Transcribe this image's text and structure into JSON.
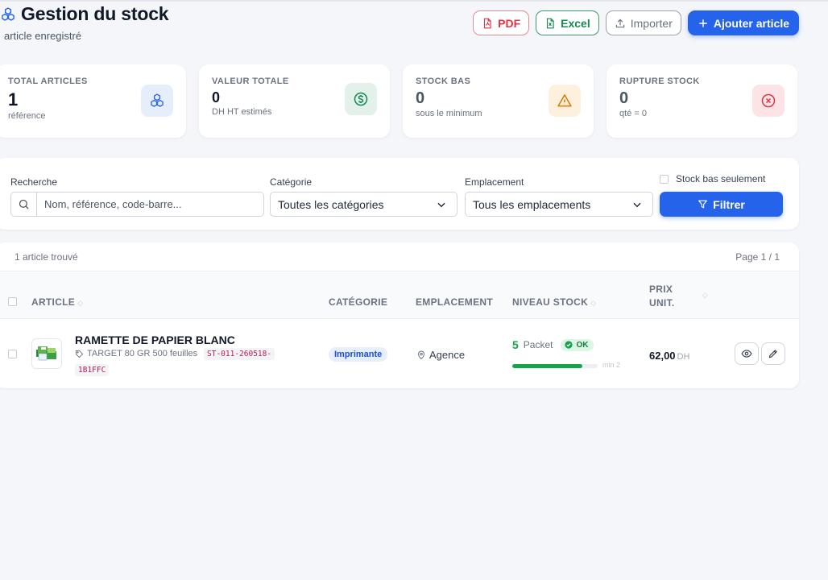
{
  "header": {
    "title": "Gestion du stock",
    "subtitle": "article enregistré",
    "buttons": {
      "pdf": "PDF",
      "excel": "Excel",
      "import": "Importer",
      "add": "Ajouter article"
    }
  },
  "stats": [
    {
      "label": "TOTAL ARTICLES",
      "value": "1",
      "sub": "référence",
      "icon": "cubes-icon",
      "color": "#2563eb"
    },
    {
      "label": "VALEUR TOTALE",
      "value": "0",
      "sub": "DH HT estimés",
      "icon": "dollar-coin-icon",
      "color": "#198754"
    },
    {
      "label": "STOCK BAS",
      "value": "0",
      "sub": "sous le minimum",
      "icon": "warning-icon",
      "color": "#d97706"
    },
    {
      "label": "RUPTURE STOCK",
      "value": "0",
      "sub": "qté = 0",
      "icon": "x-circle-icon",
      "color": "#dc3545"
    }
  ],
  "filters": {
    "search_label": "Recherche",
    "search_placeholder": "Nom, référence, code-barre...",
    "category_label": "Catégorie",
    "category_value": "Toutes les catégories",
    "location_label": "Emplacement",
    "location_value": "Tous les emplacements",
    "low_stock_label": "Stock bas seulement",
    "low_stock_checked": false,
    "filter_button": "Filtrer"
  },
  "table": {
    "count_text": "1 article trouvé",
    "page_text": "Page 1 / 1",
    "columns": {
      "article": "ARTICLE",
      "category": "CATÉGORIE",
      "location": "EMPLACEMENT",
      "stock": "NIVEAU STOCK",
      "price_line1": "PRIX",
      "price_line2": "UNIT."
    },
    "rows": [
      {
        "name": "RAMETTE DE PAPIER BLANC",
        "meta": "TARGET 80 GR 500 feuilles",
        "sku_part1": "ST-011-260518-",
        "sku_part2": "1B1FFC",
        "category": "Imprimante",
        "location": "Agence",
        "qty": "5",
        "unit": "Packet",
        "status": "OK",
        "stock_fill": 0.82,
        "min_text": "min 2",
        "price": "62,00",
        "currency": "DH"
      }
    ]
  }
}
